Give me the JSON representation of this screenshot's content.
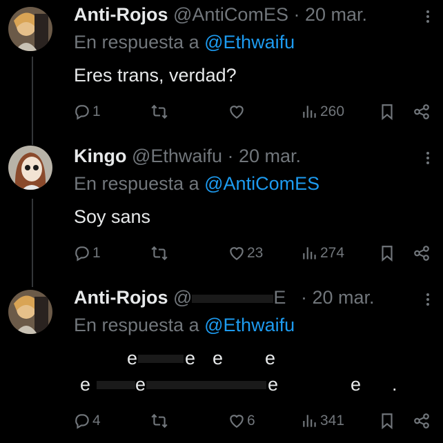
{
  "tweets": [
    {
      "name": "Anti-Rojos",
      "handle": "@AntiComES",
      "date": "· 20 mar.",
      "reply_prefix": "En respuesta a",
      "reply_to": "@Ethwaifu",
      "text": "Eres trans, verdad?",
      "replies": "1",
      "retweets": "",
      "likes": "",
      "views": "260"
    },
    {
      "name": "Kingo",
      "handle": "@Ethwaifu",
      "date": "· 20 mar.",
      "reply_prefix": "En respuesta a",
      "reply_to": "@AntiComES",
      "text": "Soy sans",
      "replies": "1",
      "retweets": "",
      "likes": "23",
      "views": "274"
    },
    {
      "name": "Anti-Rojos",
      "handle_start": "@",
      "handle_end": "E",
      "date": "· 20 mar.",
      "reply_prefix": "En respuesta a",
      "reply_to": "@Ethwaifu",
      "text_line1": [
        "e",
        "e",
        "e",
        "e"
      ],
      "text_line2": [
        "e",
        "e",
        "e",
        "e",
        "."
      ],
      "replies": "4",
      "retweets": "",
      "likes": "6",
      "views": "341"
    }
  ],
  "colors": {
    "bg": "#000000",
    "text": "#e7e9ea",
    "muted": "#71767b",
    "link": "#1d9bf0"
  },
  "icons": [
    "reply-icon",
    "retweet-icon",
    "like-icon",
    "views-icon",
    "bookmark-icon",
    "share-icon",
    "more-icon"
  ]
}
